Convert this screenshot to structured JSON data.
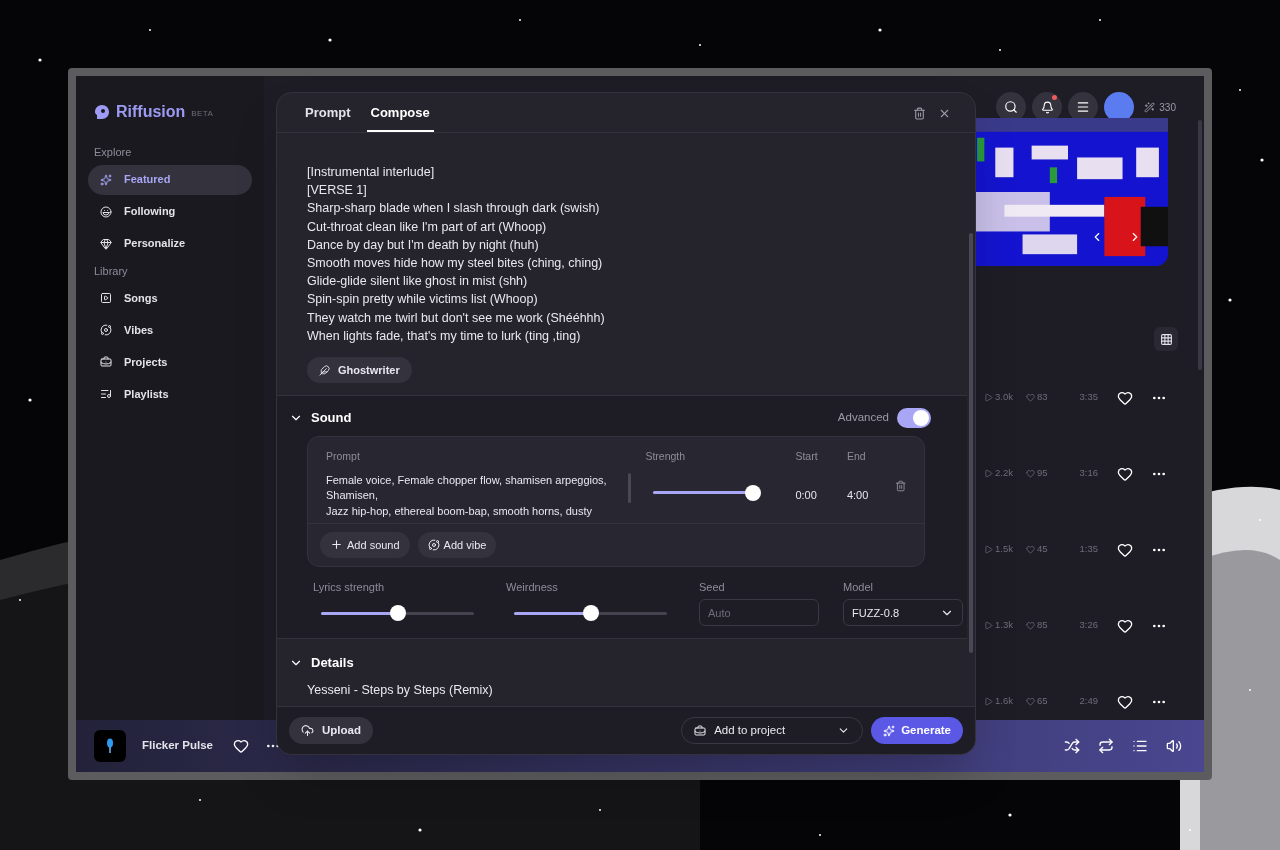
{
  "app": {
    "brand": "Riffusion",
    "badge": "BETA"
  },
  "sidebar": {
    "sections": [
      {
        "title": "Explore",
        "items": [
          {
            "label": "Featured",
            "selected": true
          },
          {
            "label": "Following",
            "selected": false
          },
          {
            "label": "Personalize",
            "selected": false
          }
        ]
      },
      {
        "title": "Library",
        "items": [
          {
            "label": "Songs",
            "selected": false
          },
          {
            "label": "Vibes",
            "selected": false
          },
          {
            "label": "Projects",
            "selected": false
          },
          {
            "label": "Playlists",
            "selected": false
          }
        ]
      }
    ]
  },
  "topbar": {
    "notifications_unread": true,
    "credits": "330"
  },
  "tracks": [
    {
      "plays": "3.0k",
      "likes": "83",
      "duration": "3:35"
    },
    {
      "plays": "2.2k",
      "likes": "95",
      "duration": "3:16"
    },
    {
      "plays": "1.5k",
      "likes": "45",
      "duration": "1:35"
    },
    {
      "plays": "1.3k",
      "likes": "85",
      "duration": "3:26"
    },
    {
      "plays": "1.6k",
      "likes": "65",
      "duration": "2:49"
    }
  ],
  "player": {
    "title": "Flicker Pulse"
  },
  "composer": {
    "tabs": [
      {
        "label": "Prompt",
        "selected": false
      },
      {
        "label": "Compose",
        "selected": true
      }
    ],
    "lyrics": [
      "[Instrumental interlude]",
      "[VERSE 1]",
      "Sharp-sharp blade when I slash through dark (swish)",
      "Cut-throat clean like I'm part of art (Whoop)",
      "Dance by day but I'm death by night (huh)",
      "Smooth moves hide how my steel bites (ching, ching)",
      "Glide-glide silent like ghost in mist (shh)",
      "Spin-spin pretty while victims list (Whoop)",
      "They watch me twirl but don't see me work (Shééhhh)",
      "When lights fade, that's my time to lurk (ting ,ting)"
    ],
    "ghostwriter": "Ghostwriter",
    "sound": {
      "title": "Sound",
      "expanded": true,
      "advanced_label": "Advanced",
      "advanced": true,
      "columns": {
        "prompt": "Prompt",
        "strength": "Strength",
        "start": "Start",
        "end": "End"
      },
      "prompts": [
        {
          "lines": [
            "Female voice, Female chopper flow, shamisen arpeggios, Shamisen,",
            "Jazz hip-hop, ethereal boom-bap, smooth horns, dusty"
          ],
          "level": 0.98,
          "start": "0:00",
          "end": "4:00"
        }
      ],
      "add_sound": "Add sound",
      "add_vibe": "Add vibe"
    },
    "lyrics_strength": {
      "label": "Lyrics strength",
      "level": 0.5
    },
    "weirdness": {
      "label": "Weirdness",
      "level": 0.5
    },
    "seed": {
      "label": "Seed",
      "placeholder": "Auto"
    },
    "model": {
      "label": "Model",
      "value": "FUZZ-0.8"
    },
    "details": {
      "title": "Details",
      "expanded": true,
      "text": "Yesseni - Steps by Steps (Remix)"
    },
    "footer": {
      "upload": "Upload",
      "add_to_project": "Add to project",
      "generate": "Generate"
    }
  }
}
